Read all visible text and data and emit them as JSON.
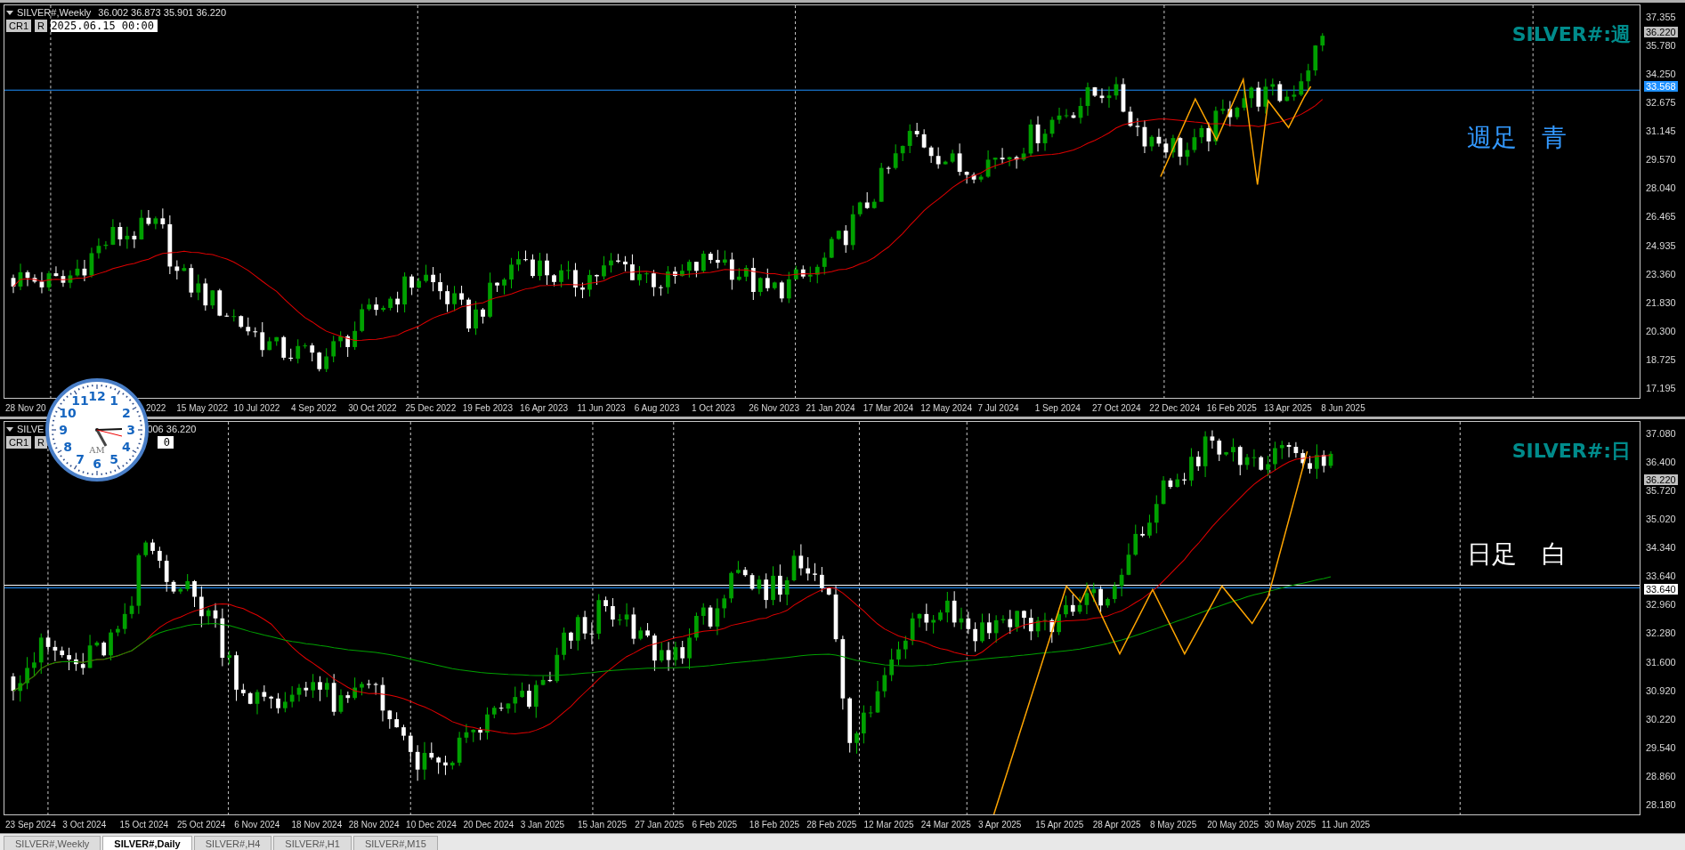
{
  "charts": [
    {
      "header": "SILVER#,Weekly",
      "quote": "36.002 36.873 35.901 36.220",
      "kind": "weekly",
      "buttons": [
        "CR1",
        "R"
      ],
      "date_field": "2025.06.15 00:00",
      "title": "SILVER#:週",
      "note": "週足　青",
      "color": "#3399ff",
      "price_ticks": [
        "37.355",
        "35.780",
        "34.250",
        "32.675",
        "31.145",
        "29.570",
        "28.040",
        "26.465",
        "24.935",
        "23.360",
        "21.830",
        "20.300",
        "18.725",
        "17.195"
      ],
      "badges": [
        {
          "text": "36.220",
          "kind": "current"
        },
        {
          "text": "33.568",
          "kind": "line"
        }
      ],
      "date_labels": [
        "28 Nov 20",
        "2022",
        "15 May 2022",
        "10 Jul 2022",
        "4 Sep 2022",
        "30 Oct 2022",
        "25 Dec 2022",
        "19 Feb 2023",
        "16 Apr 2023",
        "11 Jun 2023",
        "6 Aug 2023",
        "1 Oct 2023",
        "26 Nov 2023",
        "21 Jan 2024",
        "17 Mar 2024",
        "12 May 2024",
        "7 Jul 2024",
        "1 Sep 2024",
        "27 Oct 2024",
        "22 Dec 2024",
        "16 Feb 2025",
        "13 Apr 2025",
        "8 Jun 2025"
      ]
    },
    {
      "header": "SILVE",
      "quote": "006 36.220",
      "kind": "daily",
      "buttons": [
        "CR1",
        "R"
      ],
      "date_field": "0",
      "title": "SILVER#:日",
      "note": "日足　白",
      "color": "#ffffff",
      "price_ticks": [
        "37.080",
        "36.400",
        "35.720",
        "35.020",
        "34.340",
        "33.640",
        "32.960",
        "32.280",
        "31.600",
        "30.920",
        "30.220",
        "29.540",
        "28.860",
        "28.180"
      ],
      "badges": [
        {
          "text": "36.220",
          "kind": "current"
        },
        {
          "text": "33.640",
          "kind": "line-white"
        }
      ],
      "date_labels": [
        "23 Sep 2024",
        "3 Oct 2024",
        "15 Oct 2024",
        "25 Oct 2024",
        "6 Nov 2024",
        "18 Nov 2024",
        "28 Nov 2024",
        "10 Dec 2024",
        "20 Dec 2024",
        "3 Jan 2025",
        "15 Jan 2025",
        "27 Jan 2025",
        "6 Feb 2025",
        "18 Feb 2025",
        "28 Feb 2025",
        "12 Mar 2025",
        "24 Mar 2025",
        "3 Apr 2025",
        "15 Apr 2025",
        "28 Apr 2025",
        "8 May 2025",
        "20 May 2025",
        "30 May 2025",
        "11 Jun 2025"
      ]
    }
  ],
  "clock": {
    "numerals": [
      "11",
      "12",
      "1",
      "10",
      "2",
      "9",
      "3",
      "8",
      "4",
      "7",
      "5",
      "6"
    ],
    "period": "AM"
  },
  "tabs": [
    {
      "label": "SILVER#,Weekly",
      "selected": false
    },
    {
      "label": "SILVER#,Daily",
      "selected": true
    },
    {
      "label": "SILVER#,H4",
      "selected": false
    },
    {
      "label": "SILVER#,H1",
      "selected": false
    },
    {
      "label": "SILVER#,M15",
      "selected": false
    }
  ]
}
